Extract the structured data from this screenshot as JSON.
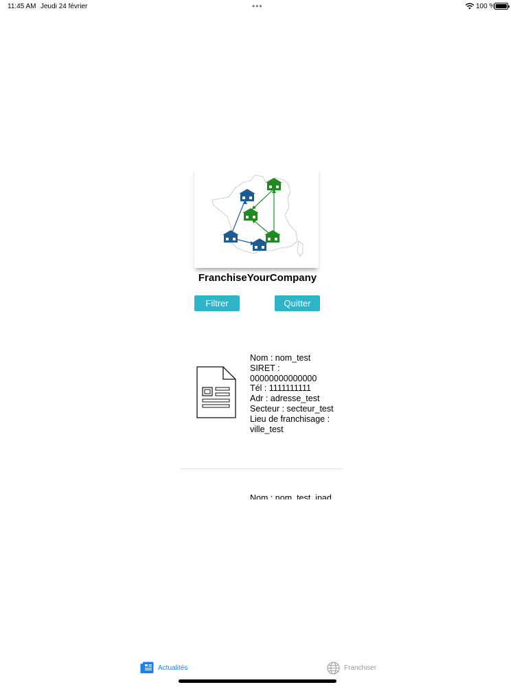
{
  "status_bar": {
    "time": "11:45 AM",
    "date": "Jeudi 24 février",
    "battery_text": "100 %"
  },
  "brand": {
    "name": "FranchiseYourCompany"
  },
  "actions": {
    "filter_label": "Filtrer",
    "quit_label": "Quitter"
  },
  "companies": [
    {
      "lines": [
        "Nom : nom_test",
        "SIRET :",
        "00000000000000",
        "Tél : 1111111111",
        "Adr : adresse_test",
        "Secteur : secteur_test",
        "Lieu de franchisage :",
        "ville_test"
      ]
    },
    {
      "lines": [
        "Nom : nom_test_ipad"
      ]
    }
  ],
  "tabbar": {
    "news_label": "Actualités",
    "franchise_label": "Franchiser"
  },
  "colors": {
    "button": "#2fb3c6",
    "tab_active": "#1a7fe6",
    "tab_inactive": "#9a9a9a",
    "house_blue": "#1e5b94",
    "house_green": "#1f8a1f"
  }
}
